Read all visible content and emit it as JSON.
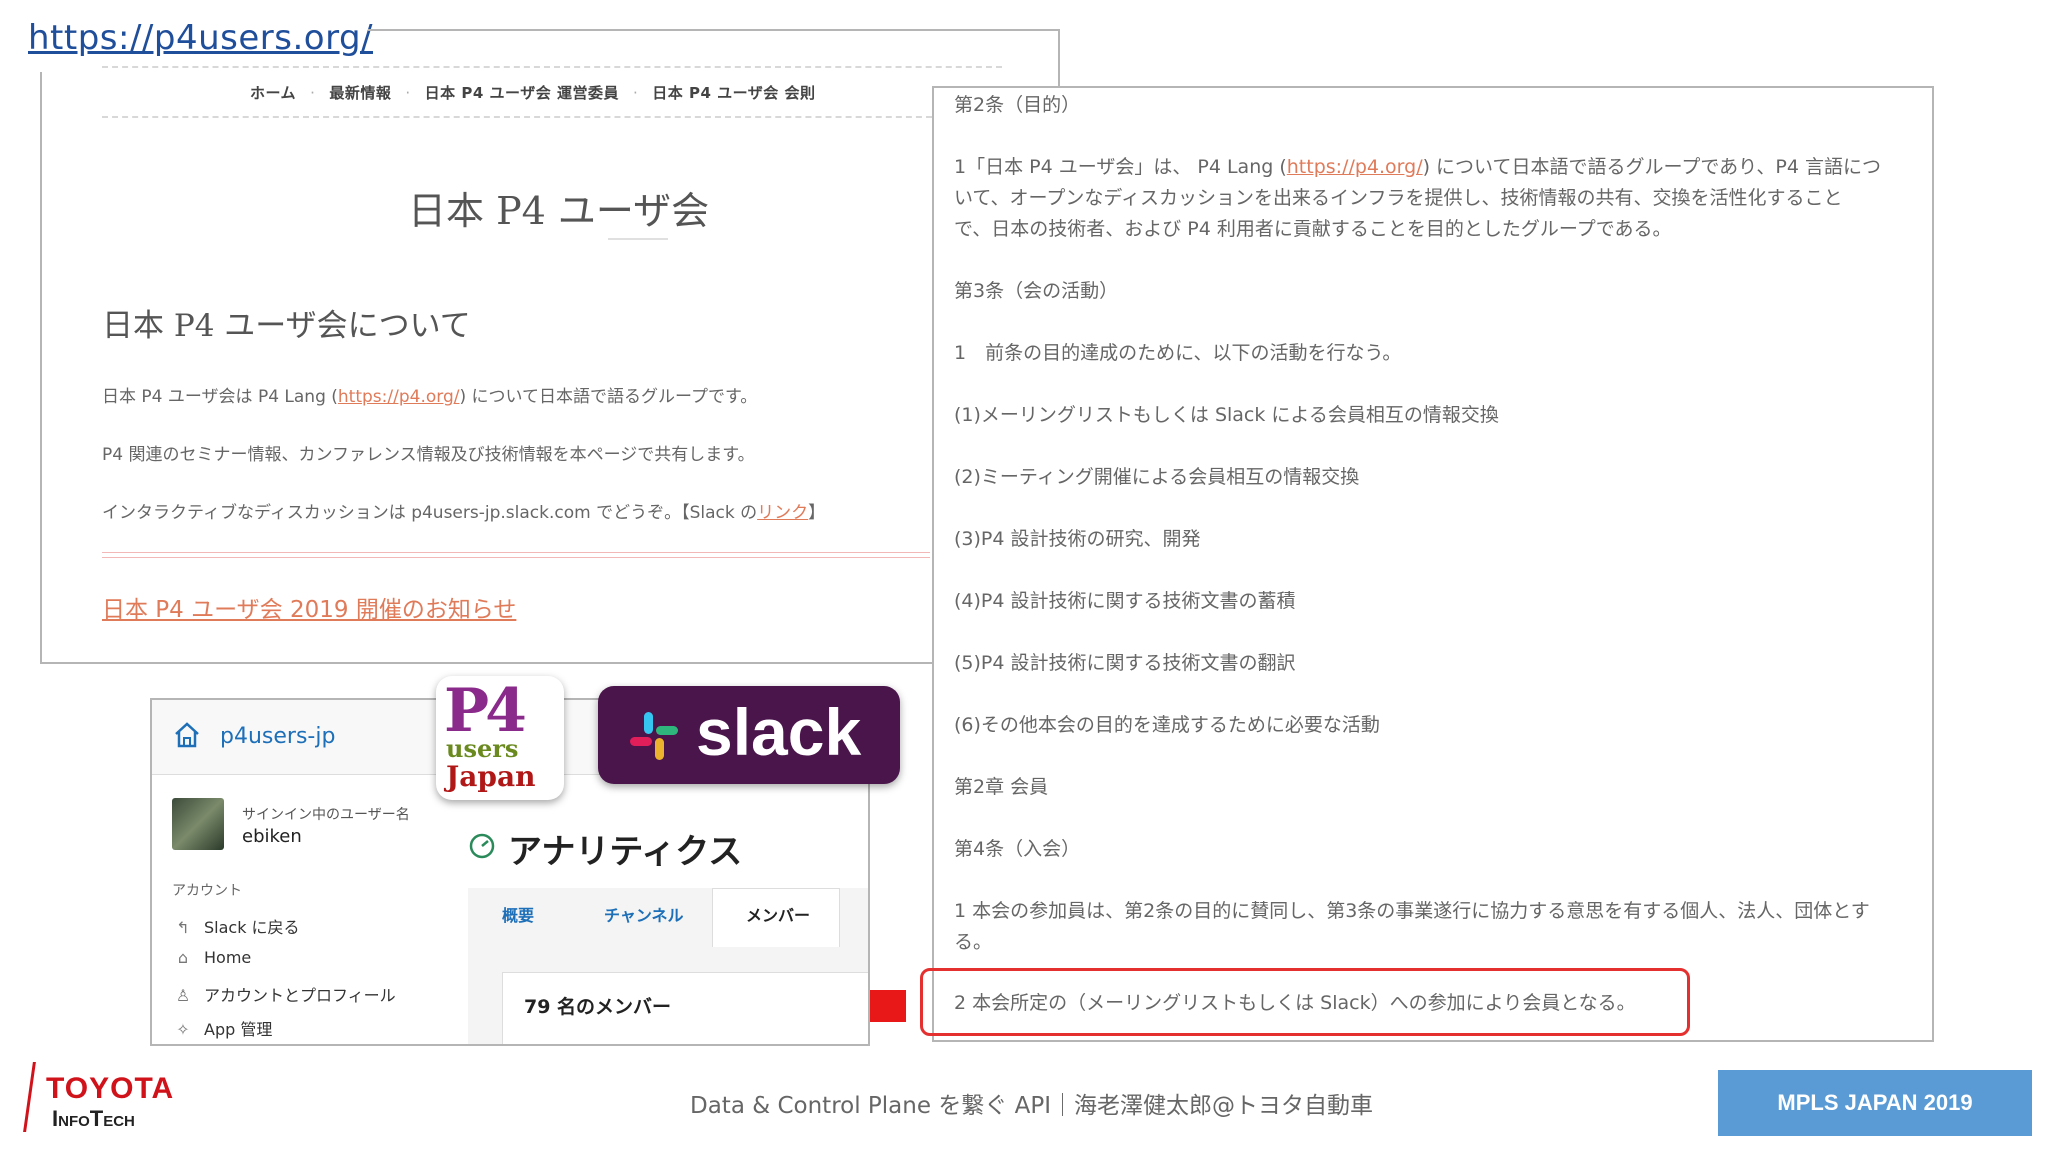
{
  "top_url": "https://p4users.org/",
  "website": {
    "nav": [
      "ホーム",
      "最新情報",
      "日本 P4 ユーザ会 運営委員",
      "日本 P4 ユーザ会 会則"
    ],
    "title": "日本 P4 ユーザ会",
    "about_heading": "日本 P4 ユーザ会について",
    "para1_a": "日本 P4 ユーザ会は P4 Lang (",
    "para1_link": "https://p4.org/",
    "para1_b": ") について日本語で語るグループです。",
    "para2": "P4 関連のセミナー情報、カンファレンス情報及び技術情報を本ページで共有します。",
    "para3_a": "インタラクティブなディスカッションは p4users-jp.slack.com でどうぞ。【Slack の",
    "para3_link": "リンク",
    "para3_b": "】",
    "news_link": "日本 P4 ユーザ会 2019 開催のお知らせ"
  },
  "bylaws": {
    "art2_title": "第2条（目的）",
    "art2_l1_a": "1「日本 P4 ユーザ会」は、 P4 Lang (",
    "art2_l1_link": "https://p4.org/",
    "art2_l1_b": ") について日本語で語るグループであり、P4 言語につ",
    "art2_l2": "いて、オープンなディスカッションを出来るインフラを提供し、技術情報の共有、交換を活性化すること",
    "art2_l3": "で、日本の技術者、および P4 利用者に貢献することを目的としたグループである。",
    "art3_title": "第3条（会の活動）",
    "art3_l1": "1　前条の目的達成のために、以下の活動を行なう。",
    "item1": "(1)メーリングリストもしくは Slack による会員相互の情報交換",
    "item2": "(2)ミーティング開催による会員相互の情報交換",
    "item3": "(3)P4 設計技術の研究、開発",
    "item4": "(4)P4 設計技術に関する技術文書の蓄積",
    "item5": "(5)P4 設計技術に関する技術文書の翻訳",
    "item6": "(6)その他本会の目的を達成するために必要な活動",
    "chapter2": "第2章 会員",
    "art4_title": "第4条（入会）",
    "art4_l1": "1 本会の参加員は、第2条の目的に賛同し、第3条の事業遂行に協力する意思を有する個人、法人、団体とす",
    "art4_l2": "る。",
    "art4_l3": "2 本会所定の（メーリングリストもしくは Slack）への参加により会員となる。"
  },
  "slack": {
    "workspace": "p4users-jp",
    "signin_label": "サインイン中のユーザー名",
    "username": "ebiken",
    "account_label": "アカウント",
    "menu": [
      "Slack に戻る",
      "Home",
      "アカウントとプロフィール",
      "App 管理"
    ],
    "analytics_title": "アナリティクス",
    "tabs": [
      "概要",
      "チャンネル",
      "メンバー"
    ],
    "members_count": "79 名のメンバー"
  },
  "logos": {
    "p4_line1": "P4",
    "p4_line2": "users",
    "p4_line3": "Japan",
    "slack_text": "slack"
  },
  "footer": {
    "text": "Data & Control Plane を繋ぐ API｜海老澤健太郎@トヨタ自動車",
    "conference": "MPLS JAPAN 2019",
    "company_line1": "TOYOTA",
    "company_line2": "InfoTech"
  },
  "colors": {
    "link": "#e07b5a",
    "highlight": "#e53030",
    "slack_purple": "#4a154b",
    "badge": "#5b9bd5",
    "url": "#1f4e9a"
  }
}
